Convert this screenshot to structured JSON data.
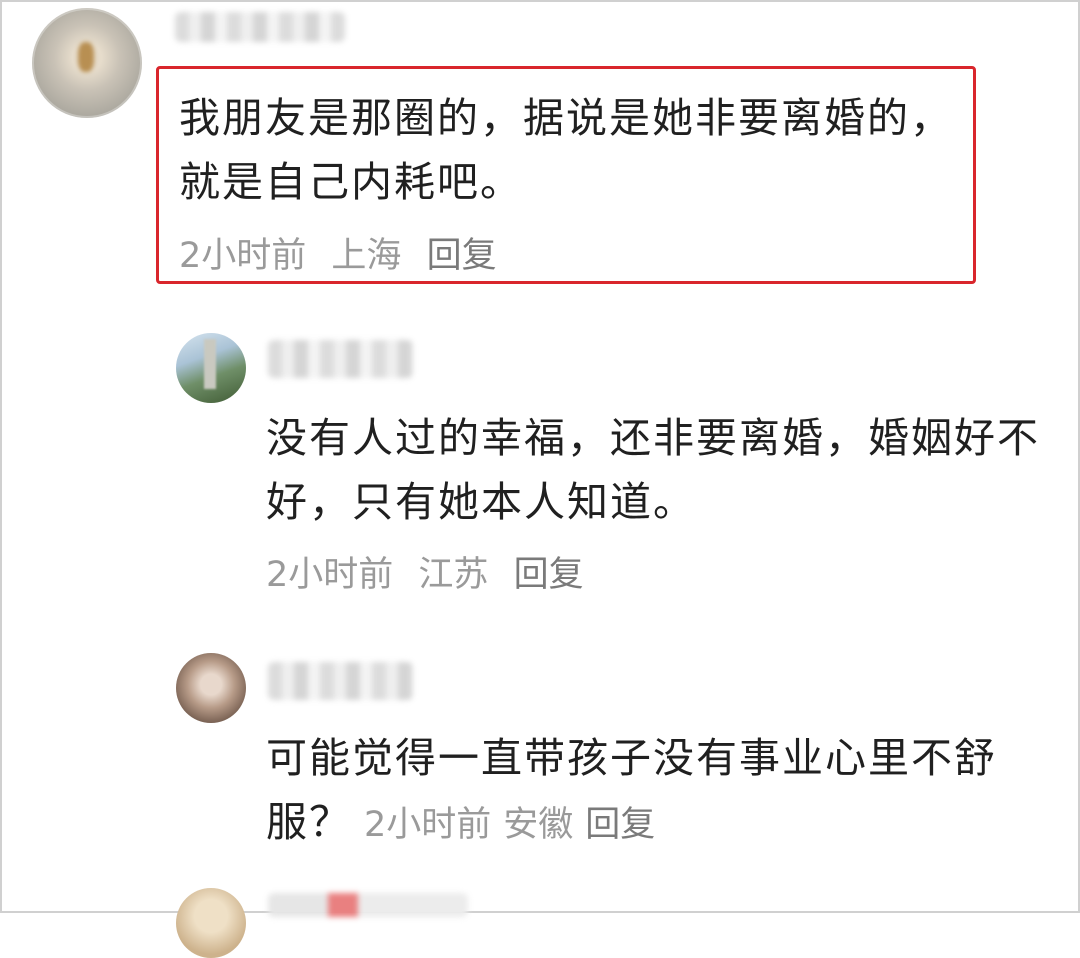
{
  "comments": [
    {
      "text": "我朋友是那圈的，据说是她非要离婚的，就是自己内耗吧。",
      "time": "2小时前",
      "location": "上海",
      "reply_label": "回复",
      "highlighted": true,
      "highlight_color": "#d9262c"
    },
    {
      "text": "没有人过的幸福，还非要离婚，婚姻好不好，只有她本人知道。",
      "time": "2小时前",
      "location": "江苏",
      "reply_label": "回复"
    },
    {
      "text": "可能觉得一直带孩子没有事业心里不舒服？",
      "time": "2小时前",
      "location": "安徽",
      "reply_label": "回复"
    }
  ]
}
